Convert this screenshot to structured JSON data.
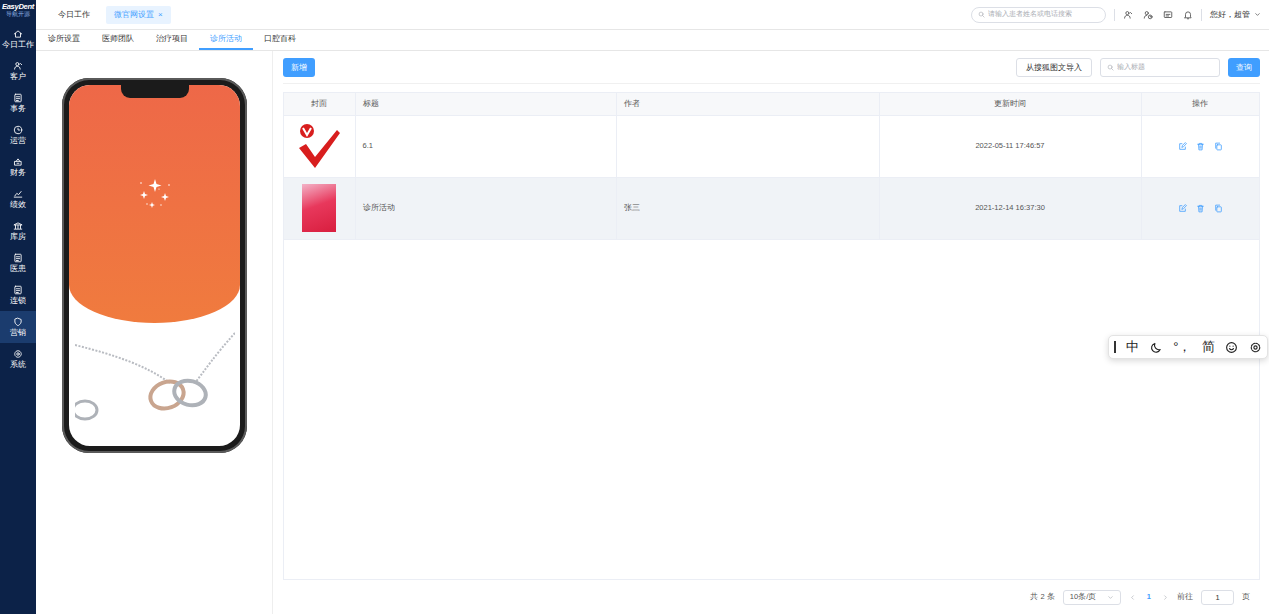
{
  "logo": {
    "name": "EasyDent",
    "tagline": "导航开源"
  },
  "sidebar": {
    "items": [
      {
        "label": "今日工作",
        "selected": false
      },
      {
        "label": "客户",
        "selected": false
      },
      {
        "label": "事务",
        "selected": false
      },
      {
        "label": "运营",
        "selected": false
      },
      {
        "label": "财务",
        "selected": false
      },
      {
        "label": "绩效",
        "selected": false
      },
      {
        "label": "库房",
        "selected": false
      },
      {
        "label": "医患",
        "selected": false
      },
      {
        "label": "连锁",
        "selected": false
      },
      {
        "label": "营销",
        "selected": true
      },
      {
        "label": "系统",
        "selected": false
      }
    ]
  },
  "top_tabs": [
    {
      "label": "今日工作",
      "selected": false,
      "closable": false
    },
    {
      "label": "微官网设置",
      "selected": true,
      "closable": true,
      "close": "×"
    }
  ],
  "global_search": {
    "placeholder": "请输入患者姓名或电话搜索"
  },
  "user": {
    "greeting": "您好，超管"
  },
  "sub_tabs": [
    {
      "label": "诊所设置",
      "selected": false
    },
    {
      "label": "医师团队",
      "selected": false
    },
    {
      "label": "治疗项目",
      "selected": false
    },
    {
      "label": "诊所活动",
      "selected": true
    },
    {
      "label": "口腔百科",
      "selected": false
    }
  ],
  "toolbar": {
    "add": "新增",
    "import": "从搜狐图文导入",
    "search": {
      "placeholder": "输入标题"
    },
    "query": "查询"
  },
  "table": {
    "columns": [
      "封面",
      "标题",
      "作者",
      "更新时间",
      "操作"
    ],
    "rows": [
      {
        "kind": "logo",
        "title": "6.1",
        "author": "",
        "updated": "2022-05-11 17:46:57",
        "hovered": false
      },
      {
        "kind": "poster",
        "title": "诊所活动",
        "author": "张三",
        "updated": "2021-12-14 16:37:30",
        "hovered": true
      }
    ]
  },
  "pagination": {
    "total": "共 2 条",
    "page_size": "10条/页",
    "pages": [
      {
        "label": "1",
        "selected": true
      }
    ],
    "goto": "前往",
    "goto_value": "1",
    "unit": "页"
  },
  "ime": {
    "mode": "中",
    "punct": "°，",
    "charset": "简"
  }
}
